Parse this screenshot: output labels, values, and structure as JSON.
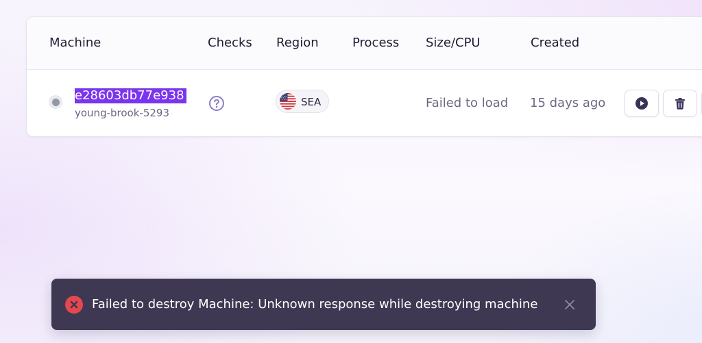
{
  "table": {
    "headers": {
      "machine": "Machine",
      "checks": "Checks",
      "region": "Region",
      "process": "Process",
      "size_cpu": "Size/CPU",
      "created": "Created"
    },
    "rows": [
      {
        "status": "stopped",
        "machine_id": "e28603db77e938",
        "machine_name": "young-brook-5293",
        "checks_icon": "question-circle-icon",
        "region_flag": "us-flag-icon",
        "region_code": "SEA",
        "process": "",
        "size_cpu": "Failed to load",
        "created": "15 days ago",
        "actions": [
          {
            "name": "start",
            "icon": "play-icon"
          },
          {
            "name": "destroy",
            "icon": "trash-icon"
          },
          {
            "name": "more",
            "icon": "more-icon"
          }
        ]
      }
    ]
  },
  "toast": {
    "type": "error",
    "icon": "error-x-icon",
    "message": "Failed to destroy Machine: Unknown response while destroying machine",
    "close_icon": "close-icon"
  },
  "colors": {
    "selection": "#7b35ee",
    "toast_bg": "#3f3852",
    "error": "#e5484d",
    "icon_purple": "#3a3358"
  }
}
